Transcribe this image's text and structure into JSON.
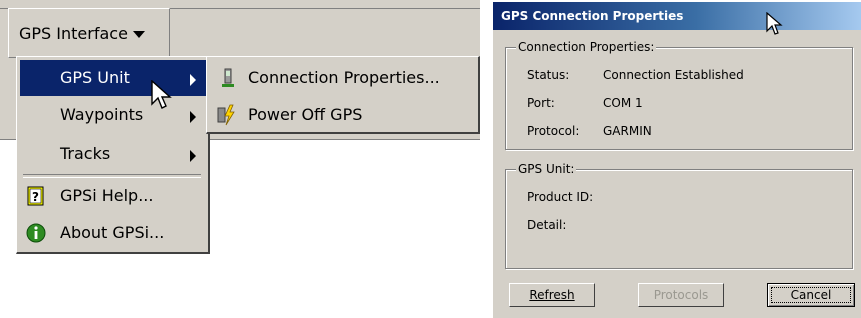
{
  "menu_screen": {
    "toolbar_button": {
      "label": "GPS Interface",
      "icon": "chevron-down-icon"
    },
    "menu_items": [
      {
        "label": "GPS Unit",
        "has_submenu": true,
        "highlighted": true
      },
      {
        "label": "Waypoints",
        "has_submenu": true
      },
      {
        "label": "Tracks",
        "has_submenu": true
      },
      {
        "label": "GPSi Help...",
        "icon": "help-book-icon"
      },
      {
        "label": "About GPSi...",
        "icon": "info-icon"
      }
    ],
    "submenu_items": [
      {
        "label": "Connection Properties...",
        "icon": "gps-device-icon"
      },
      {
        "label": "Power Off GPS",
        "icon": "lightning-icon"
      }
    ],
    "colors": {
      "menu_highlight": "#0a246a",
      "menu_bg": "#d4d0c8"
    }
  },
  "dialog": {
    "title": "GPS Connection Properties",
    "connection_group": {
      "legend": "Connection Properties:",
      "fields": [
        {
          "label": "Status:",
          "value": "Connection Established"
        },
        {
          "label": "Port:",
          "value": "COM 1"
        },
        {
          "label": "Protocol:",
          "value": "GARMIN"
        }
      ]
    },
    "unit_group": {
      "legend": "GPS Unit:",
      "fields": [
        {
          "label": "Product ID:",
          "value": ""
        },
        {
          "label": "Detail:",
          "value": ""
        }
      ]
    },
    "buttons": {
      "refresh": "Refresh",
      "protocols": "Protocols",
      "cancel": "Cancel"
    },
    "colors": {
      "title_start": "#0a246a",
      "title_end": "#a6caf0"
    }
  }
}
